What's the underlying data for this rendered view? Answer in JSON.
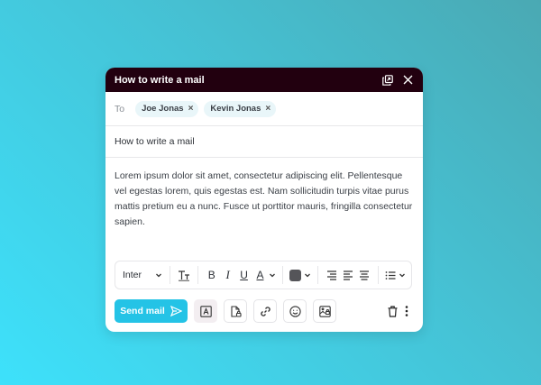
{
  "window": {
    "title": "How to write a mail"
  },
  "recipients": {
    "label": "To",
    "chips": [
      {
        "name": "Joe Jonas",
        "remove": "×"
      },
      {
        "name": "Kevin Jonas",
        "remove": "×"
      }
    ]
  },
  "subject": "How to write a mail",
  "body": "Lorem ipsum dolor sit amet, consectetur adipiscing elit. Pellentesque vel egestas lorem, quis egestas est. Nam sollicitudin turpis vitae purus mattis pretium eu a nunc. Fusce ut porttitor mauris, fringilla consectetur sapien.",
  "toolbar": {
    "font": "Inter",
    "bold": "B",
    "italic": "I",
    "underline": "U",
    "text_color": "A",
    "swatch_color": "#555559"
  },
  "actions": {
    "send_label": "Send mail"
  },
  "colors": {
    "accent": "#24c3e6",
    "titlebar": "#22000f"
  }
}
